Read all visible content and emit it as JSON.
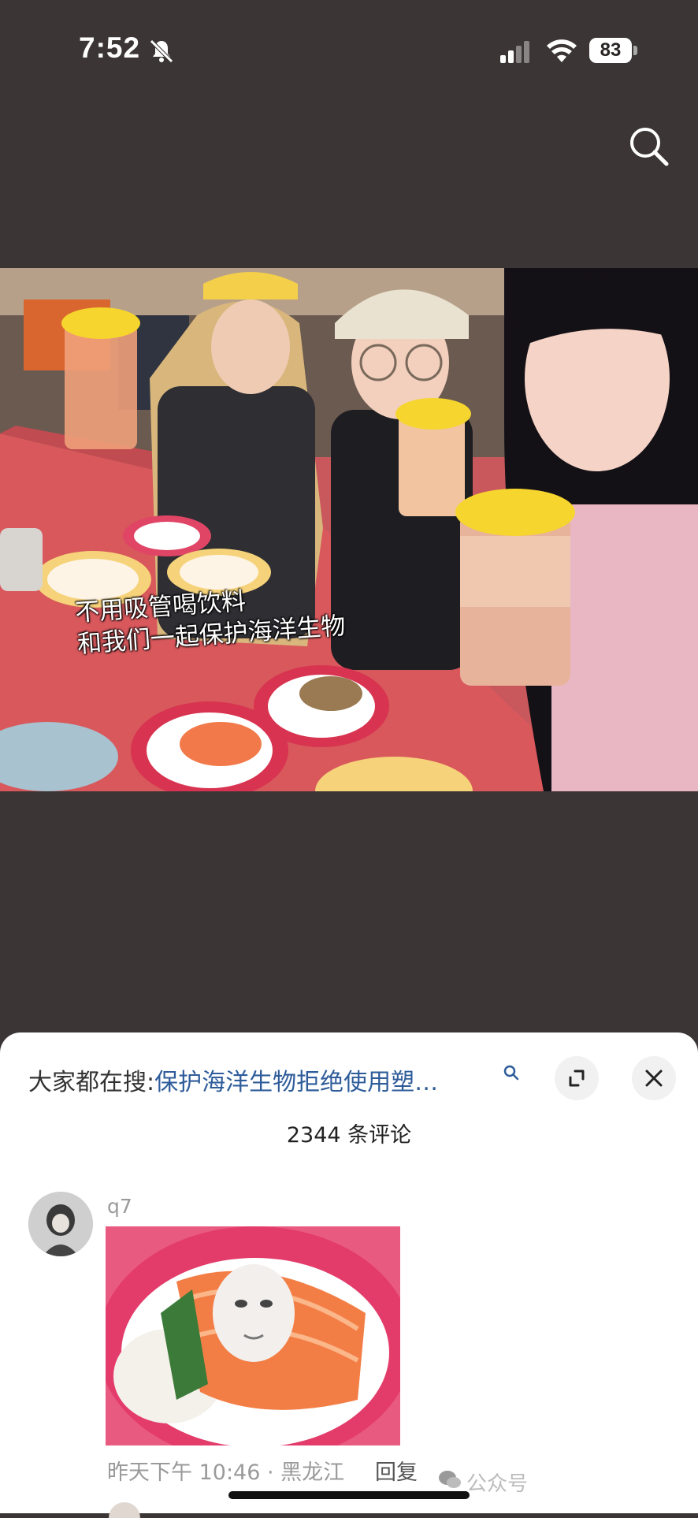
{
  "status_bar": {
    "time": "7:52",
    "battery": "83"
  },
  "photo": {
    "caption_line1": "不用吸管喝饮料",
    "caption_line2": "和我们一起保护海洋生物"
  },
  "comments_sheet": {
    "trending_prefix": "大家都在搜:",
    "trending_query": "保护海洋生物拒绝使用塑…",
    "comment_count": "2344 条评论",
    "comment": {
      "username": "q7",
      "timestamp_location": "昨天下午 10:46 · 黑龙江",
      "reply_label": "回复"
    },
    "watermark": "公众号"
  },
  "colors": {
    "background": "#3b3535",
    "sheet": "#ffffff",
    "link": "#2e5c9a"
  }
}
